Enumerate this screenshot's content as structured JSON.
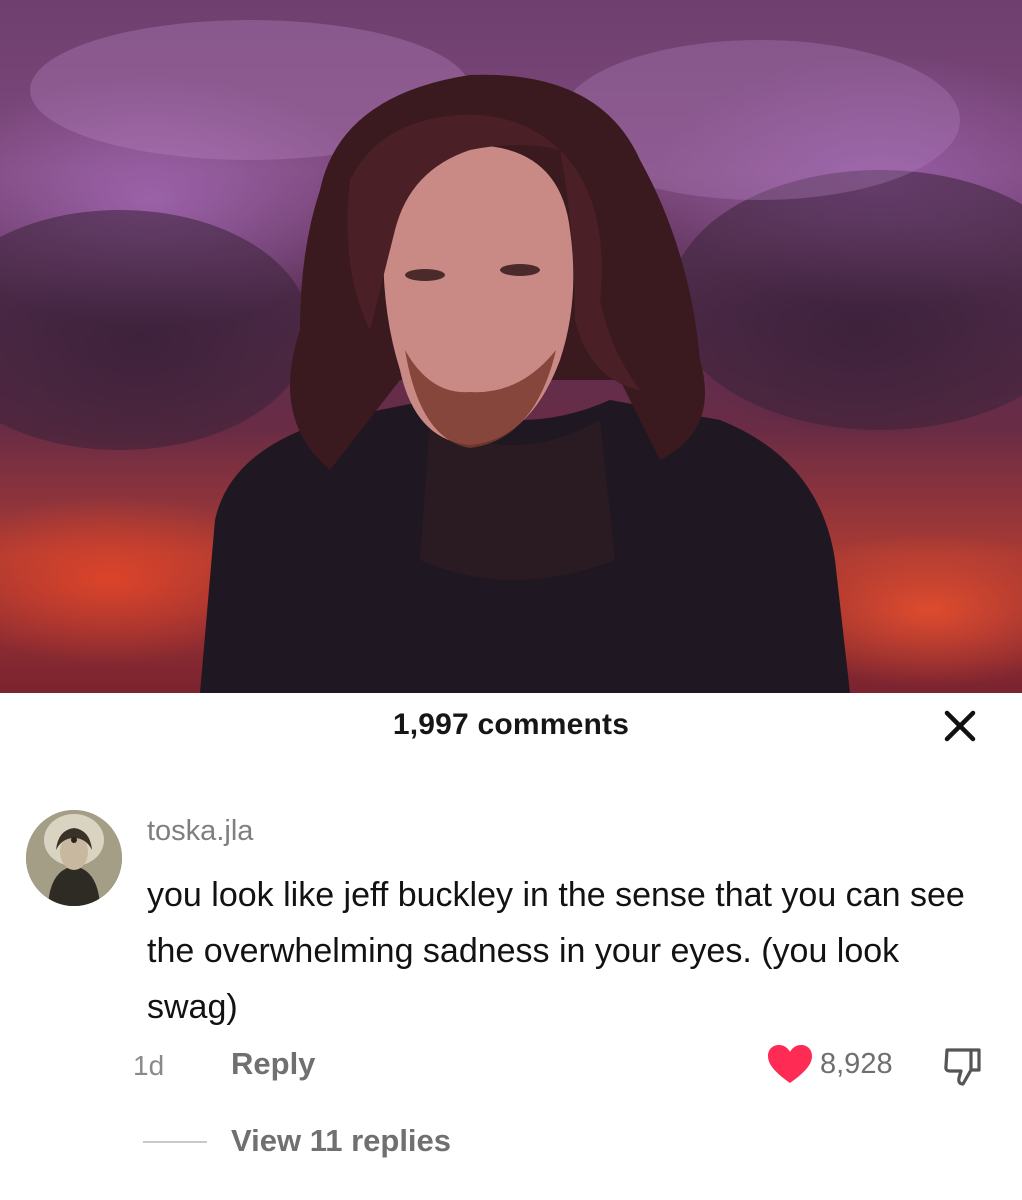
{
  "post": {
    "image_description_icon": "portrait-photo",
    "colors": {
      "sky_purple": "#7e4a7d",
      "sky_red": "#a83a34"
    }
  },
  "comments_panel": {
    "title": "1,997 comments",
    "close_icon": "close-icon"
  },
  "comment": {
    "username": "toska.jla",
    "text": "you look like jeff buckley in the sense that you can see the overwhelming sadness in your eyes. (you look swag)",
    "time": "1d",
    "reply_label": "Reply",
    "like_count": "8,928",
    "liked": true,
    "like_color": "#fe2c55",
    "view_replies_label": "View 11 replies"
  }
}
